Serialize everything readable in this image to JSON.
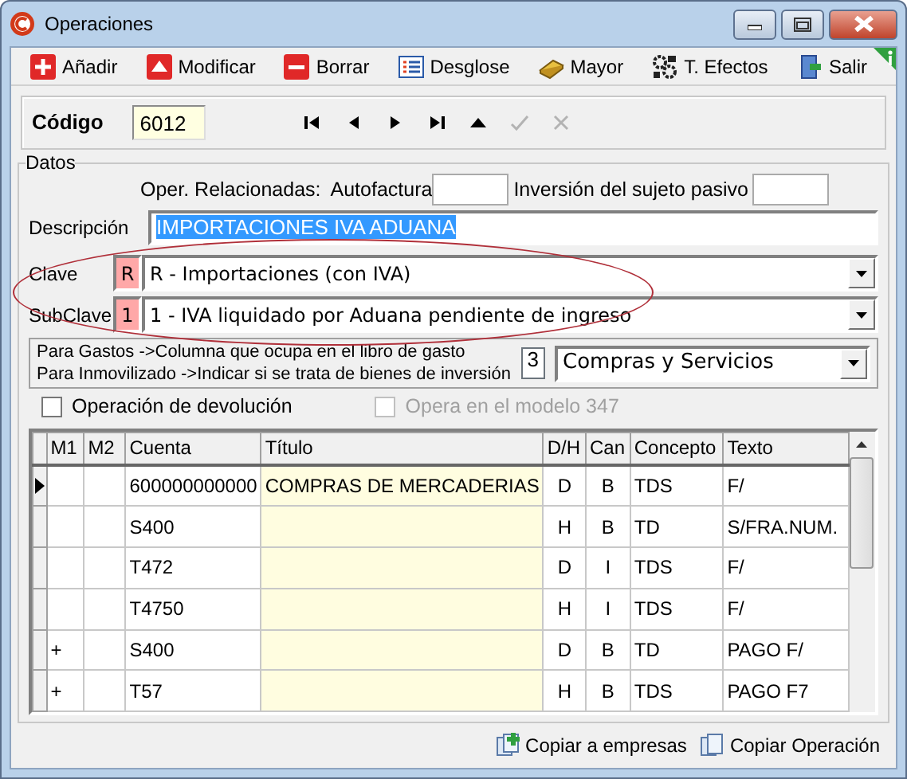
{
  "window": {
    "title": "Operaciones"
  },
  "toolbar": [
    {
      "label": "Añadir",
      "kind": "add"
    },
    {
      "label": "Modificar",
      "kind": "edit"
    },
    {
      "label": "Borrar",
      "kind": "delete"
    },
    {
      "label": "Desglose",
      "kind": "list"
    },
    {
      "label": "Mayor",
      "kind": "ledger"
    },
    {
      "label": "T. Efectos",
      "kind": "effects"
    },
    {
      "label": "Salir",
      "kind": "exit"
    }
  ],
  "record": {
    "label": "Código",
    "value": "6012",
    "nav": [
      {
        "kind": "first",
        "disabled": false
      },
      {
        "kind": "prev",
        "disabled": false
      },
      {
        "kind": "next",
        "disabled": false
      },
      {
        "kind": "last",
        "disabled": false
      },
      {
        "kind": "up",
        "disabled": false
      },
      {
        "kind": "confirm",
        "disabled": true
      },
      {
        "kind": "cancel",
        "disabled": true
      }
    ]
  },
  "datos": {
    "legend": "Datos",
    "related_label": "Oper. Relacionadas:",
    "autofactura_label": "Autofactura",
    "inversion_label": "Inversión del sujeto pasivo",
    "descripcion": {
      "label": "Descripción",
      "value": "IMPORTACIONES IVA ADUANA",
      "text_selected": true
    },
    "clave": {
      "label": "Clave",
      "code": "R",
      "value": "R - Importaciones (con IVA)"
    },
    "subclave": {
      "label": "SubClave",
      "code": "1",
      "value": "1 - IVA liquidado por Aduana pendiente de ingreso"
    },
    "gasto": {
      "lines": [
        "Para Gastos ->Columna que ocupa en el libro de gasto",
        "Para Inmovilizado ->Indicar si se trata de bienes de inversión"
      ],
      "number": "3",
      "value": "Compras y Servicios"
    },
    "checks": [
      {
        "label": "Operación de devolución",
        "checked": false,
        "disabled": false
      },
      {
        "label": "Opera en el modelo  347",
        "checked": false,
        "disabled": true
      }
    ]
  },
  "table": {
    "columns": [
      "M1",
      "M2",
      "Cuenta",
      "Título",
      "D/H",
      "Can",
      "Concepto",
      "Texto"
    ],
    "rows": [
      {
        "selected": true,
        "cuenta": "600000000000",
        "titulo": "COMPRAS DE MERCADERIAS",
        "dh": "D",
        "can": "B",
        "concepto": "TDS",
        "texto": "F/"
      },
      {
        "selected": false,
        "cuenta": "S400",
        "dh": "H",
        "can": "B",
        "concepto": "TD",
        "texto": "S/FRA.NUM."
      },
      {
        "selected": false,
        "cuenta": "T472",
        "dh": "D",
        "can": "I",
        "concepto": "TDS",
        "texto": "F/"
      },
      {
        "selected": false,
        "cuenta": "T4750",
        "dh": "H",
        "can": "I",
        "concepto": "TDS",
        "texto": "F/"
      },
      {
        "selected": false,
        "m1": "+",
        "cuenta": "S400",
        "dh": "D",
        "can": "B",
        "concepto": "TD",
        "texto": "PAGO F/"
      },
      {
        "selected": false,
        "m1": "+",
        "cuenta": "T57",
        "dh": "H",
        "can": "B",
        "concepto": "TDS",
        "texto": "PAGO F7"
      }
    ]
  },
  "footer": [
    {
      "label": "Copiar a empresas",
      "kind": "copy-add"
    },
    {
      "label": "Copiar Operación",
      "kind": "copy"
    }
  ]
}
